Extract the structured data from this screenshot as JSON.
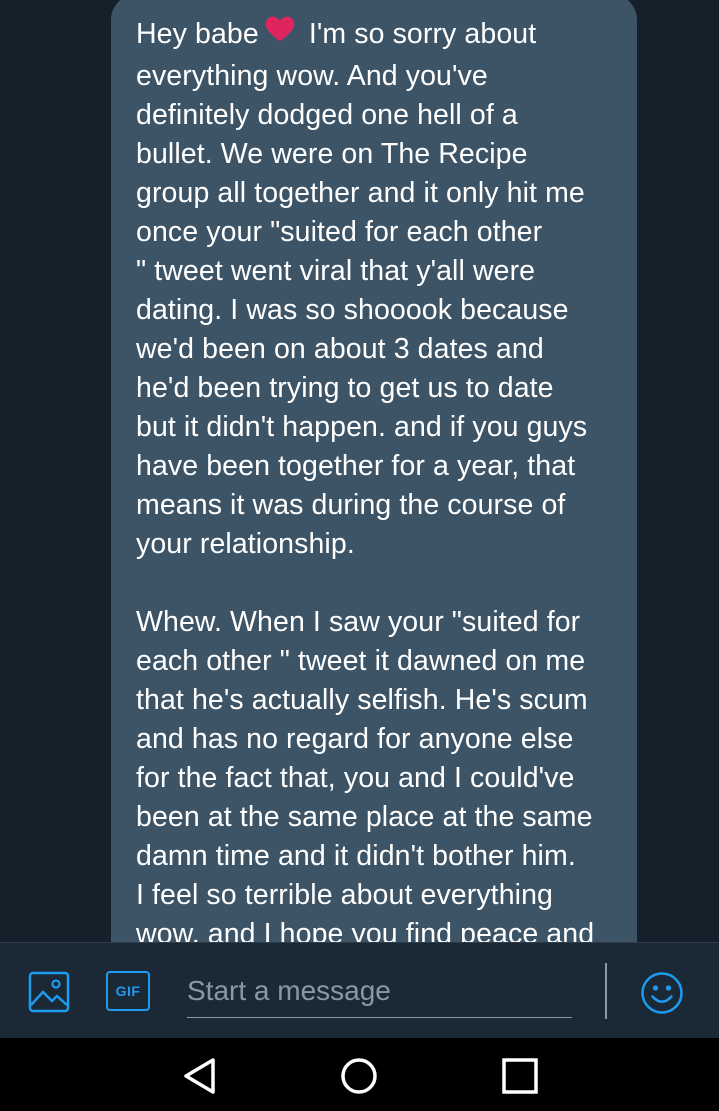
{
  "message": {
    "line_before_heart": "Hey babe",
    "text_after_heart": " I'm so sorry about\neverything wow. And you've\ndefinitely dodged one hell of a\nbullet. We were on The Recipe\ngroup all together and it only hit me\nonce your \"suited for each other\n\" tweet went viral that y'all were\ndating. I was so shooook because\nwe'd been on about 3 dates and\nhe'd been trying to get us to date\nbut it didn't happen. and if you guys\nhave been together for a year, that\nmeans it was during the course of\nyour relationship.\n\nWhew. When I saw your \"suited for\neach other \" tweet it dawned on me\nthat he's actually selfish. He's scum\nand has no regard for anyone else\nfor the fact that, you and I could've\nbeen at the same place at the same\ndamn time and it didn't bother him.\nI feel so terrible about everything\nwow, and I hope you find peace and",
    "heart_color": "#e0245e"
  },
  "composer": {
    "placeholder": "Start a message",
    "gif_label": "GIF",
    "icons": [
      "media-icon",
      "gif-icon",
      "emoji-icon"
    ],
    "accent_color": "#1d9bf0"
  },
  "navbar": {
    "icons": [
      "back-triangle-icon",
      "home-circle-icon",
      "recents-square-icon"
    ]
  }
}
